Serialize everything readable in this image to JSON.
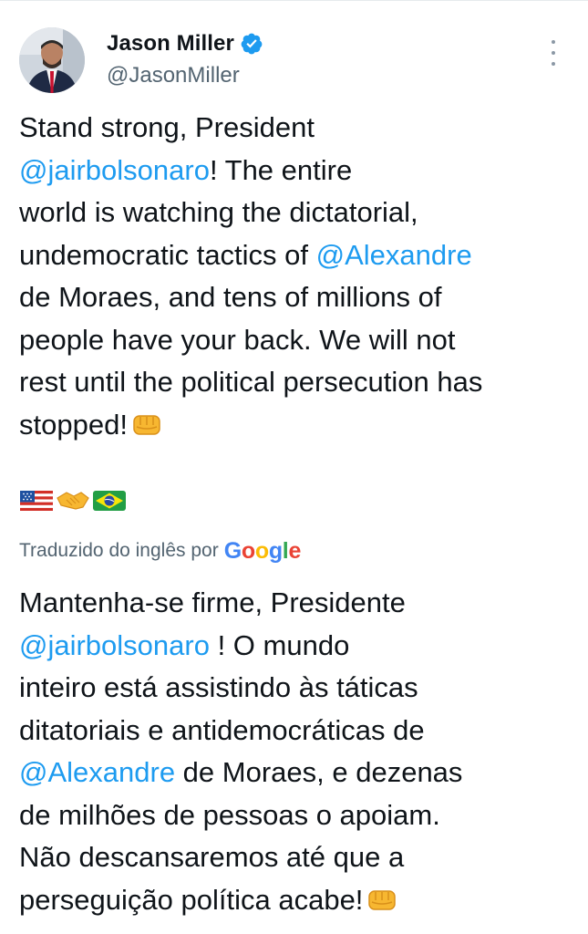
{
  "author": {
    "name": "Jason Miller",
    "handle": "@JasonMiller",
    "verified": true,
    "avatar_icon": "profile-photo"
  },
  "tweet": {
    "line1": "Stand strong, President",
    "mention1": "@jairbolsonaro",
    "line2_rest": "! The entire",
    "line3": "world is watching the dictatorial,",
    "line4_pre": "undemocratic tactics of ",
    "mention2": "@Alexandre",
    "line5": "de Moraes, and tens of millions of",
    "line6": "people have your back. We will not",
    "line7": "rest until the political persecution has",
    "line8": "stopped!",
    "fist_icon": "oncoming-fist-emoji",
    "flag_icons": [
      "us-flag-emoji",
      "handshake-emoji",
      "brazil-flag-emoji"
    ]
  },
  "translation": {
    "label": "Traduzido do inglês por",
    "provider": {
      "letters": [
        "G",
        "o",
        "o",
        "g",
        "l",
        "e"
      ]
    },
    "line1": "Mantenha-se firme, Presidente",
    "mention1": "@jairbolsonaro",
    "line2_rest": " ! O mundo",
    "line3": "inteiro está assistindo às táticas",
    "line4": "ditatoriais e antidemocráticas de",
    "mention2": "@Alexandre",
    "line5_rest": " de Moraes, e dezenas",
    "line6": "de milhões de pessoas o apoiam.",
    "line7": "Não descansaremos até que a",
    "line8": "perseguição política acabe!"
  },
  "colors": {
    "link": "#1d9bf0",
    "text": "#0f1419",
    "secondary": "#536471"
  }
}
